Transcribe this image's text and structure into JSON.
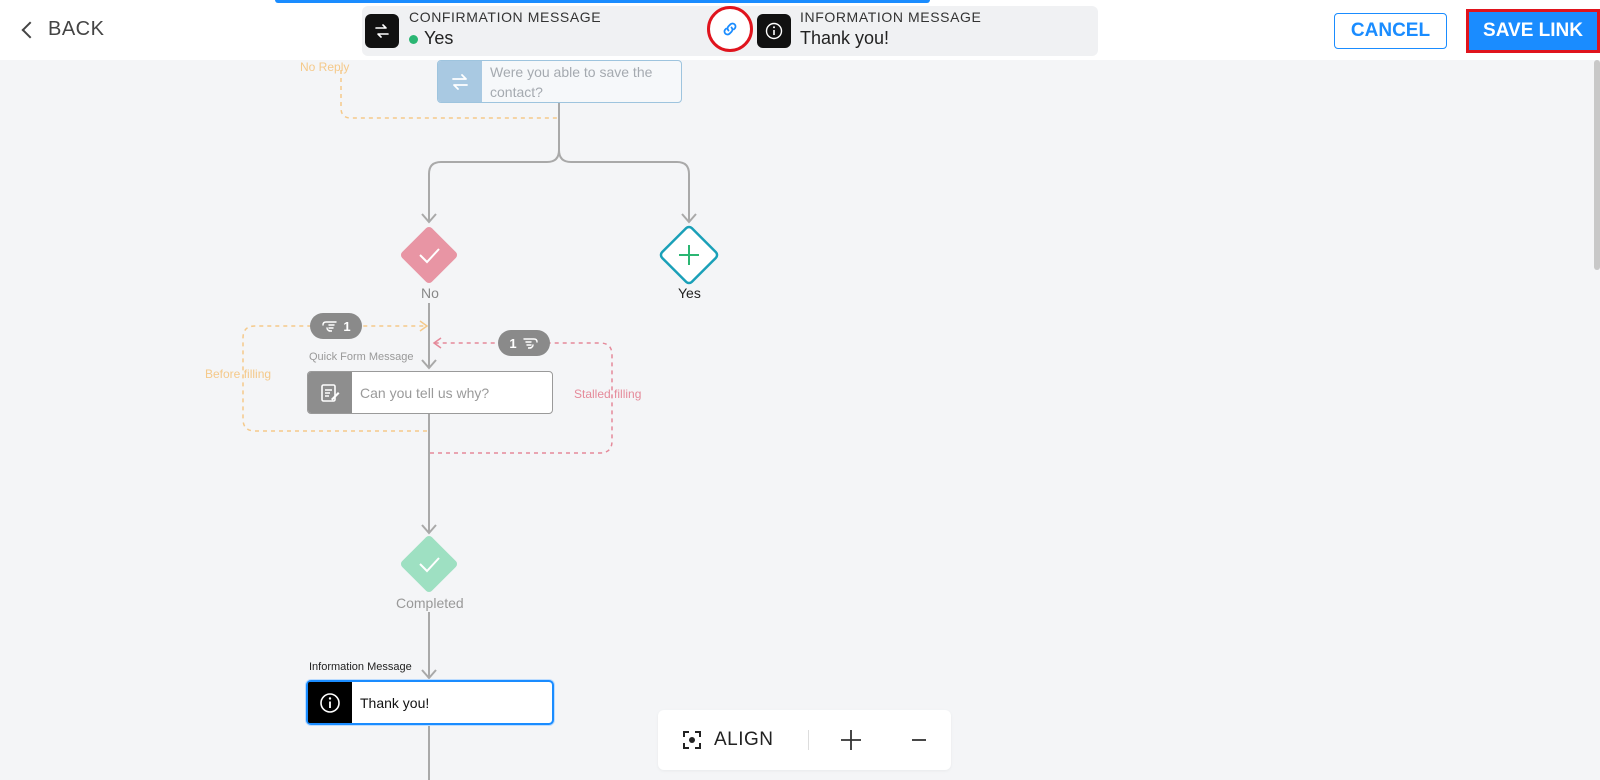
{
  "header": {
    "back_label": "BACK",
    "cancel_label": "CANCEL",
    "save_label": "SAVE LINK"
  },
  "link_panel": {
    "source": {
      "caption": "CONFIRMATION MESSAGE",
      "value": "Yes",
      "icon": "swap-arrows-icon"
    },
    "target": {
      "caption": "INFORMATION MESSAGE",
      "value": "Thank you!",
      "icon": "info-icon"
    },
    "link_icon": "chain-link-icon"
  },
  "flow": {
    "no_reply_label": "No Reply",
    "top_node": {
      "text_line1": "Were you able to save the",
      "text_line2": "contact?",
      "icon": "swap-arrows-icon"
    },
    "branch_no": {
      "label": "No",
      "icon": "check-icon"
    },
    "branch_yes": {
      "label": "Yes",
      "icon": "plus-icon"
    },
    "pill_left": "1",
    "pill_right": "1",
    "form_node": {
      "caption": "Quick Form Message",
      "text": "Can you tell us why?",
      "icon": "form-edit-icon"
    },
    "before_filling_label": "Before filling",
    "stalled_filling_label": "Stalled filling",
    "completed": {
      "label": "Completed",
      "icon": "check-icon"
    },
    "info_node": {
      "caption": "Information Message",
      "text": "Thank you!",
      "icon": "info-icon"
    }
  },
  "toolbar": {
    "align_label": "ALIGN",
    "zoom_in_icon": "plus-icon",
    "zoom_out_icon": "minus-icon"
  },
  "colors": {
    "accent": "#1a8cff",
    "highlight_red": "#e0141d",
    "no_branch": "#e895a4",
    "yes_branch": "#1aa0b8",
    "completed": "#9ee0c2",
    "before_filling": "#f5c98a",
    "stalled_filling": "#e58a9a"
  }
}
